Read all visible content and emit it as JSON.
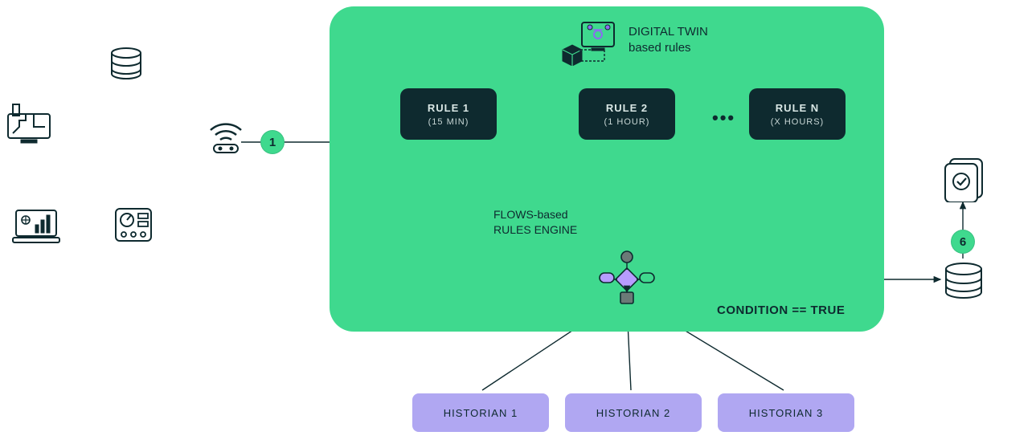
{
  "header": {
    "digital_twin_line1": "DIGITAL TWIN",
    "digital_twin_line2": "based rules"
  },
  "rules": {
    "r1": {
      "title": "RULE 1",
      "sub": "(15 MIN)"
    },
    "r2": {
      "title": "RULE 2",
      "sub": "(1 HOUR)"
    },
    "rn": {
      "title": "RULE N",
      "sub": "(X HOURS)"
    },
    "ellipsis": "•••"
  },
  "flows": {
    "line1": "FLOWS-based",
    "line2": "RULES ENGINE"
  },
  "condition": "CONDITION == TRUE",
  "historians": {
    "h1": "HISTORIAN 1",
    "h2": "HISTORIAN 2",
    "h3": "HISTORIAN 3"
  },
  "steps": {
    "s1": "1",
    "s6": "6"
  }
}
